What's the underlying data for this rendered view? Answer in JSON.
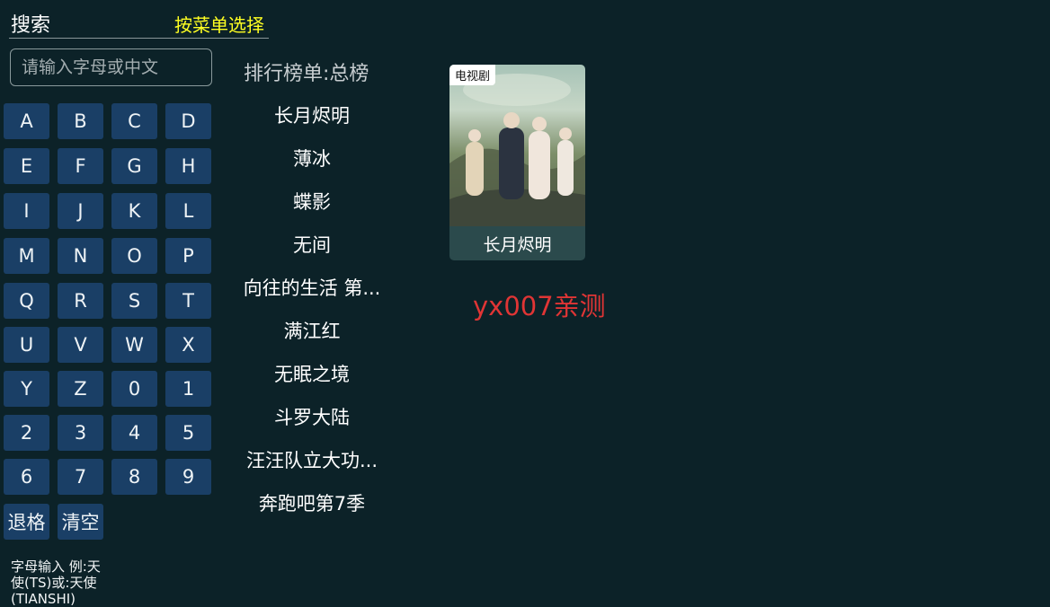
{
  "header": {
    "title": "搜索",
    "hint": "按菜单选择"
  },
  "search": {
    "placeholder": "请输入字母或中文"
  },
  "keyboard": {
    "keys": [
      "A",
      "B",
      "C",
      "D",
      "E",
      "F",
      "G",
      "H",
      "I",
      "J",
      "K",
      "L",
      "M",
      "N",
      "O",
      "P",
      "Q",
      "R",
      "S",
      "T",
      "U",
      "V",
      "W",
      "X",
      "Y",
      "Z",
      "0",
      "1",
      "2",
      "3",
      "4",
      "5",
      "6",
      "7",
      "8",
      "9"
    ],
    "backspace": "退格",
    "clear": "清空"
  },
  "helper_text": "字母输入 例:天使(TS)或:天使(TIANSHI)",
  "ranking": {
    "title": "排行榜单:总榜",
    "items": [
      "长月烬明",
      "薄冰",
      "蝶影",
      "无间",
      "向往的生活 第...",
      "满江红",
      "无眠之境",
      "斗罗大陆",
      "汪汪队立大功...",
      "奔跑吧第7季"
    ]
  },
  "result_card": {
    "tag": "电视剧",
    "title": "长月烬明"
  },
  "overlay_text": "yx007亲测",
  "colors": {
    "background": "#0c2228",
    "key": "#1a3f66",
    "hint": "#ffff22",
    "overlay": "#e03535"
  }
}
